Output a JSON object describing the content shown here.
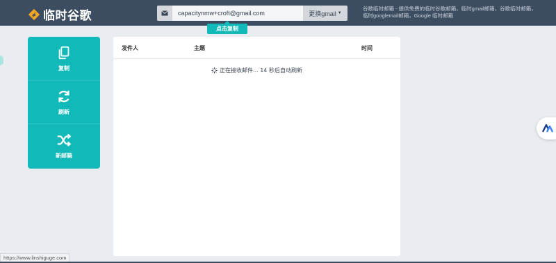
{
  "brand": {
    "name": "临时谷歌",
    "logo_color": "#f5a623"
  },
  "email": {
    "address": "capacitynmw+croft@gmail.com",
    "switch_label": "更换gmail",
    "copy_tip": "点击复制"
  },
  "tagline": "谷歌临时邮箱 - 提供免费的临时谷歌邮箱，临时gmail邮箱，谷歌临时邮箱，临时googlemail邮箱，Google 临时邮箱",
  "sidebar": {
    "accent": "#11bab8",
    "items": [
      {
        "label": "复制",
        "icon": "copy-icon"
      },
      {
        "label": "刷新",
        "icon": "refresh-icon"
      },
      {
        "label": "新邮箱",
        "icon": "shuffle-icon"
      }
    ]
  },
  "inbox": {
    "columns": {
      "from": "发件人",
      "subject": "主题",
      "time": "时间"
    },
    "status": "正在接收邮件... 14 秒后自动刷新"
  },
  "status_url": "https://www.linshiguge.com"
}
